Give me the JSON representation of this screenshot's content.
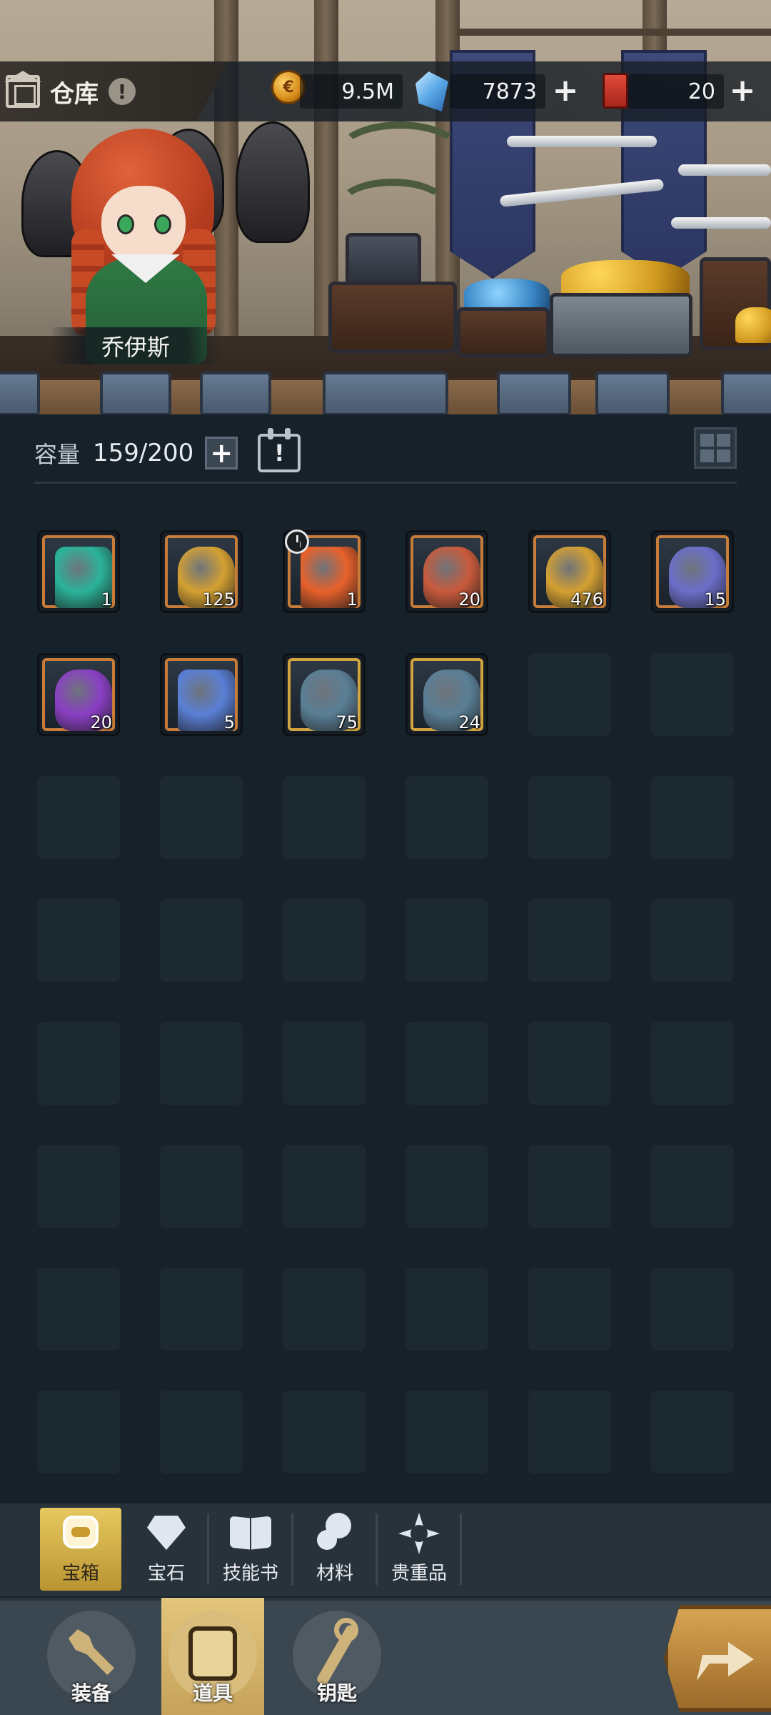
{
  "header": {
    "title": "仓库",
    "alert_glyph": "!",
    "character_name": "乔伊斯",
    "resources": [
      {
        "icon": "gold-coin-icon",
        "value": "9.5M",
        "has_plus": false
      },
      {
        "icon": "blue-crystal-icon",
        "value": "7873",
        "has_plus": true
      },
      {
        "icon": "red-ticket-icon",
        "value": "20",
        "has_plus": true
      }
    ],
    "plus_glyph": "+"
  },
  "capacity": {
    "label": "容量",
    "value": "159/200",
    "plus_glyph": "+",
    "calendar_glyph": "!"
  },
  "inventory": {
    "items": [
      {
        "icon": "teal-chest-icon",
        "qty": "1",
        "color": "#2bb39a",
        "frame": "orange"
      },
      {
        "icon": "gold-vase-icon",
        "qty": "125",
        "color": "#d4a032",
        "frame": "orange"
      },
      {
        "icon": "fire-chest-icon",
        "qty": "1",
        "color": "#e8612a",
        "frame": "orange",
        "timer": true
      },
      {
        "icon": "red-vase-icon",
        "qty": "20",
        "color": "#c95a3c",
        "frame": "orange"
      },
      {
        "icon": "gold-vase-icon",
        "qty": "476",
        "color": "#d4a032",
        "frame": "orange"
      },
      {
        "icon": "purple-vase-icon",
        "qty": "15",
        "color": "#6b6ec9",
        "frame": "orange"
      },
      {
        "icon": "purple-gold-vase-icon",
        "qty": "20",
        "color": "#8a3fc4",
        "frame": "orange"
      },
      {
        "icon": "blue-chest-icon",
        "qty": "5",
        "color": "#5a7fd6",
        "frame": "orange"
      },
      {
        "icon": "steel-vase-icon",
        "qty": "75",
        "color": "#5a7f96",
        "frame": "gold"
      },
      {
        "icon": "steel-vase-icon",
        "qty": "24",
        "color": "#5a7f96",
        "frame": "gold"
      }
    ],
    "empty_slots": 38
  },
  "categories": [
    {
      "label": "宝箱",
      "icon": "chest-icon",
      "active": true
    },
    {
      "label": "宝石",
      "icon": "diamond-icon",
      "active": false
    },
    {
      "label": "技能书",
      "icon": "book-icon",
      "active": false
    },
    {
      "label": "材料",
      "icon": "materials-icon",
      "active": false
    },
    {
      "label": "贵重品",
      "icon": "valuables-icon",
      "active": false
    }
  ],
  "bottom_nav": [
    {
      "label": "装备",
      "icon": "equipment-icon",
      "active": false
    },
    {
      "label": "道具",
      "icon": "items-icon",
      "active": true
    },
    {
      "label": "钥匙",
      "icon": "key-icon",
      "active": false
    }
  ],
  "colors": {
    "background": "#17212a",
    "active_tab": "#e7c85f",
    "empty_slot": "#1d2931"
  }
}
